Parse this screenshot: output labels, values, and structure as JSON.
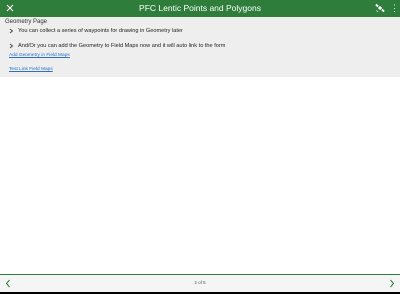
{
  "header": {
    "title": "PFC Lentic Points and Polygons",
    "close_icon": "close-icon",
    "satellite_icon": "satellite-icon",
    "color": "#2f7d3b"
  },
  "group": {
    "title": "Geometry Page",
    "notes": [
      "You can collect a series of waypoints for drawing in Geometry later",
      "And/Or you can add the Geometry to Field Maps now and it will auto link to the form"
    ],
    "links": [
      "Add Geometry in Field Maps",
      "Test Link Field Maps"
    ]
  },
  "footer": {
    "page_indicator": "2 of 5",
    "prev_icon": "chevron-left-icon",
    "next_icon": "chevron-right-icon"
  },
  "colors": {
    "accent": "#2f7d3b",
    "link": "#2a6fc4",
    "group_background": "#eeeeee"
  }
}
